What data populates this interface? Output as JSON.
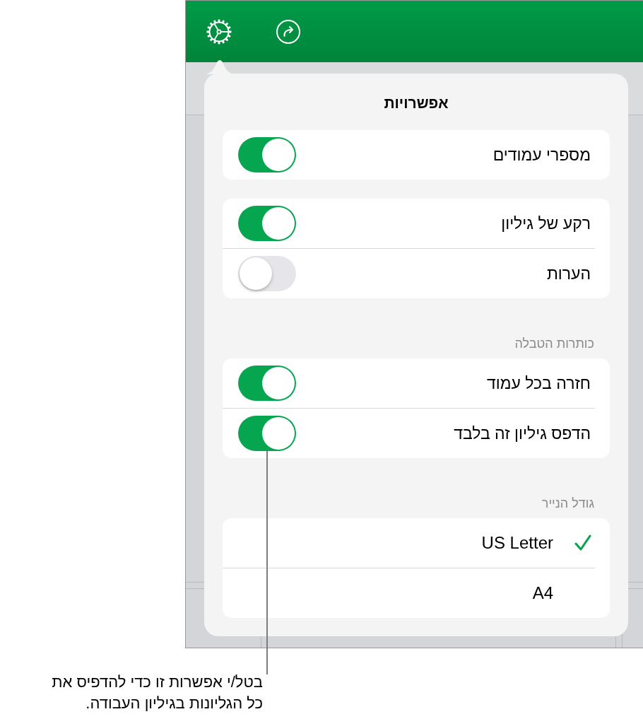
{
  "popover": {
    "title": "אפשרויות",
    "sections": [
      {
        "rows": [
          {
            "kind": "toggle",
            "label": "מספרי עמודים",
            "on": true
          }
        ]
      },
      {
        "rows": [
          {
            "kind": "toggle",
            "label": "רקע של גיליון",
            "on": true
          },
          {
            "kind": "toggle",
            "label": "הערות",
            "on": false
          }
        ]
      },
      {
        "header": "כותרות הטבלה",
        "rows": [
          {
            "kind": "toggle",
            "label": "חזרה בכל עמוד",
            "on": true
          },
          {
            "kind": "toggle",
            "label": "הדפס גיליון זה בלבד",
            "on": true
          }
        ]
      },
      {
        "header": "גודל הנייר",
        "rows": [
          {
            "kind": "option",
            "label": "US Letter",
            "selected": true
          },
          {
            "kind": "option",
            "label": "A4",
            "selected": false
          }
        ]
      }
    ]
  },
  "callout": {
    "lines": [
      "בטל/י אפשרות זו כדי להדפיס את",
      "כל הגליונות בגיליון העבודה."
    ]
  }
}
